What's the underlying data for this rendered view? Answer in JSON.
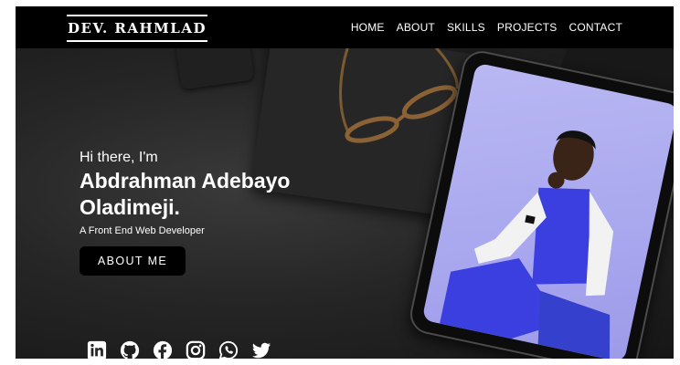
{
  "header": {
    "logo": "DEV. RAHMLAD",
    "nav": [
      {
        "label": "HOME"
      },
      {
        "label": "ABOUT"
      },
      {
        "label": "SKILLS"
      },
      {
        "label": "PROJECTS"
      },
      {
        "label": "CONTACT"
      }
    ]
  },
  "hero": {
    "greeting": "Hi there, I'm",
    "name_line1": "Abdrahman Adebayo",
    "name_line2": "Oladimeji.",
    "role": "A Front End Web Developer",
    "cta": "ABOUT ME"
  },
  "socials": [
    "linkedin-icon",
    "github-icon",
    "facebook-icon",
    "instagram-icon",
    "whatsapp-icon",
    "twitter-icon"
  ],
  "colors": {
    "navbar": "#000000",
    "hero_bg": "#262626",
    "text": "#ffffff",
    "button": "#000000",
    "tablet_screen": "#b9b8f3",
    "suit": "#3b3fe0"
  }
}
